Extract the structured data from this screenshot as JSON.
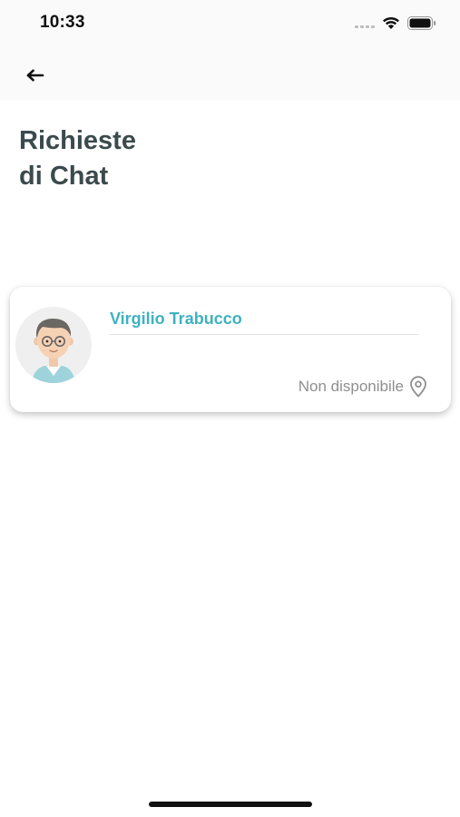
{
  "status_bar": {
    "time": "10:33"
  },
  "nav": {
    "back_icon": "arrow-left-icon"
  },
  "header": {
    "title_line1": "Richieste",
    "title_line2": "di Chat"
  },
  "chat_requests": [
    {
      "name": "Virgilio Trabucco",
      "availability": "Non disponibile",
      "avatar_icon": "user-avatar-icon",
      "location_icon": "map-pin-icon"
    }
  ],
  "colors": {
    "accent": "#3fb1c1",
    "title": "#3b4a4d",
    "muted_text": "#8f8f8f"
  }
}
